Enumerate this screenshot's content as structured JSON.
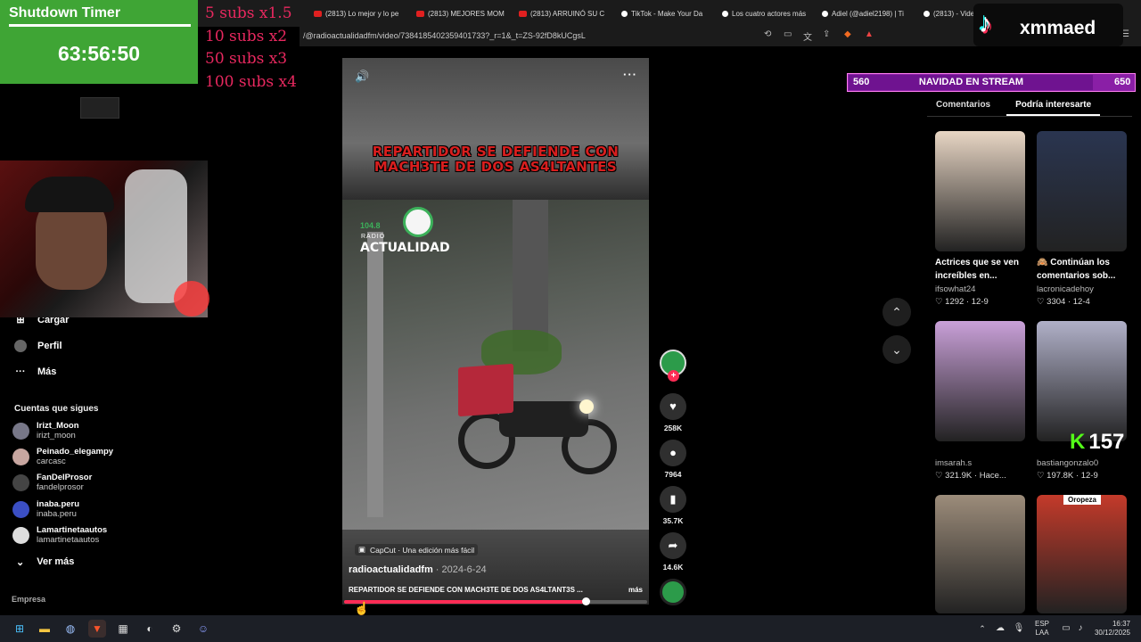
{
  "browser": {
    "tabs": [
      {
        "label": "(2813) Lo mejor y lo pe",
        "icon": "youtube-icon"
      },
      {
        "label": "(2813) MEJORES MOM",
        "icon": "youtube-icon"
      },
      {
        "label": "(2813) ARRUINÓ SU C",
        "icon": "youtube-icon"
      },
      {
        "label": "TikTok - Make Your Da",
        "icon": "tiktok-icon"
      },
      {
        "label": "Los cuatro actores más",
        "icon": "tiktok-icon"
      },
      {
        "label": "Adiel (@adiel2198) | Ti",
        "icon": "tiktok-icon"
      }
    ],
    "active_tab_label": "(2813) - Vide",
    "url": "/@radioactualidadfm/video/7384185402359401733?_r=1&_t=ZS-92fD8kUCgsL"
  },
  "overlays": {
    "timer_title": "Shutdown Timer",
    "timer_value": "63:56:50",
    "subs": [
      "5 subs x1.5",
      "10 subs x2",
      "50 subs x3",
      "100 subs x4"
    ],
    "tiktok_handle": "xmmaed",
    "stream_bar": {
      "left": "560",
      "title": "NAVIDAD EN STREAM",
      "right": "650",
      "fill_fraction": 0.85
    },
    "kick_count": "157"
  },
  "sidebar": {
    "items": [
      {
        "label": "Cargar",
        "icon": "upload-icon"
      },
      {
        "label": "Perfil",
        "icon": "profile-icon"
      },
      {
        "label": "Más",
        "icon": "more-icon"
      }
    ],
    "following_title": "Cuentas que sigues",
    "accounts": [
      {
        "name": "Irizt_Moon",
        "handle": "irizt_moon"
      },
      {
        "name": "Peinado_elegampy",
        "handle": "carcasc"
      },
      {
        "name": "FanDelProsor",
        "handle": "fandelprosor"
      },
      {
        "name": "inaba.peru",
        "handle": "inaba.peru"
      },
      {
        "name": "Lamartinetaautos",
        "handle": "lamartinetaautos"
      }
    ],
    "see_more": "Ver más",
    "company": "Empresa"
  },
  "video": {
    "headline": "REPARTIDOR SE DEFIENDE CON MACH3TE DE DOS AS4LTANTES",
    "radio_freq": "104.8",
    "radio_word": "RADIO",
    "radio_name": "ACTUALIDAD",
    "capcut": "CapCut · Una edición más fácil",
    "author": "radioactualidadfm",
    "date": " · 2024-6-24",
    "caption": "REPARTIDOR SE DEFIENDE CON MACH3TE DE DOS AS4LTANT3S ...",
    "caption_more": "más",
    "progress_fraction": 0.79,
    "actions": {
      "likes": "258K",
      "comments": "7964",
      "saves": "35.7K",
      "shares": "14.6K"
    }
  },
  "right_panel": {
    "tabs": [
      "Comentarios",
      "Podría interesarte"
    ],
    "active_tab": "Podría interesarte",
    "videos": [
      {
        "title": "Actrices que se ven increíbles en...",
        "author": "ifsowhat24",
        "likes": "1292",
        "date": "12-9",
        "thumb_color": "#e8d6c4"
      },
      {
        "title": "🙈 Continúan los comentarios sob...",
        "author": "lacronicadehoy",
        "likes": "3304",
        "date": "12-4",
        "thumb_color": "#2a3550"
      },
      {
        "title": "",
        "author": "imsarah.s",
        "likes": "321.9K",
        "date": "Hace...",
        "thumb_color": "#c9a0d8"
      },
      {
        "title": "",
        "author": "bastiangonzalo0",
        "likes": "197.8K",
        "date": "12-9",
        "thumb_color": "#b0b0c8"
      },
      {
        "title": "",
        "author": "",
        "likes": "",
        "date": "",
        "thumb_color": "#9c8c7a"
      },
      {
        "title": "",
        "author": "",
        "likes": "",
        "date": "",
        "thumb_color": "#c43a2a",
        "badge": "Oropeza"
      }
    ]
  },
  "taskbar": {
    "lang_top": "ESP",
    "lang_bottom": "LAA",
    "time": "16:37",
    "date": "30/12/2025"
  }
}
